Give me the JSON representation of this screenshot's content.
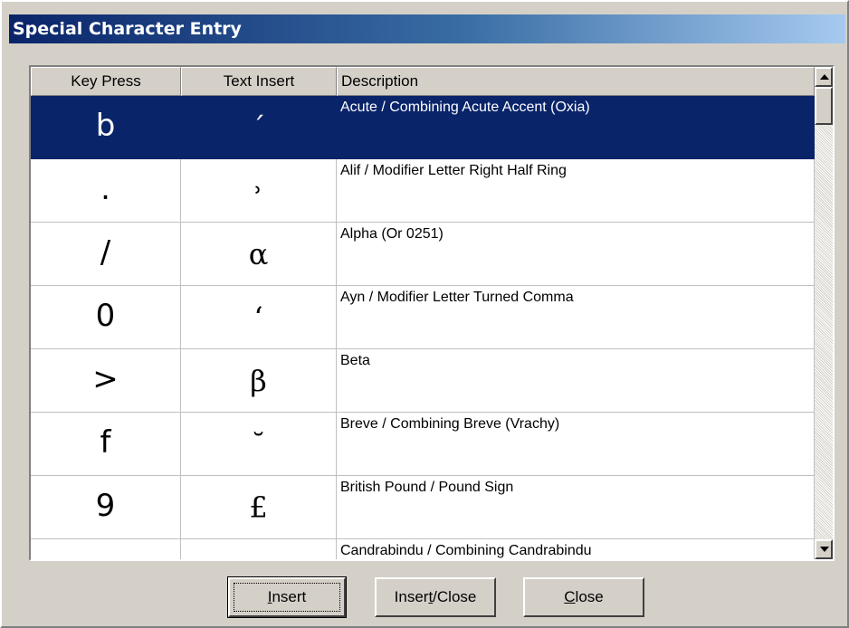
{
  "window": {
    "title": "Special Character Entry"
  },
  "table": {
    "columns": [
      "Key Press",
      "Text Insert",
      "Description"
    ],
    "selected_index": 0,
    "rows": [
      {
        "key": "b",
        "insert": "´",
        "description": "Acute / Combining Acute Accent (Oxia)"
      },
      {
        "key": ".",
        "insert": "˒",
        "description": "Alif / Modifier Letter Right Half Ring"
      },
      {
        "key": "/",
        "insert": "α",
        "description": "Alpha (Or 0251)"
      },
      {
        "key": "0",
        "insert": "ʻ",
        "description": "Ayn / Modifier Letter Turned Comma"
      },
      {
        "key": ">",
        "insert": "β",
        "description": "Beta"
      },
      {
        "key": "f",
        "insert": "˘",
        "description": "Breve / Combining Breve (Vrachy)"
      },
      {
        "key": "9",
        "insert": "£",
        "description": "British Pound / Pound Sign"
      },
      {
        "key": "",
        "insert": "",
        "description": "Candrabindu / Combining Candrabindu"
      }
    ]
  },
  "buttons": {
    "insert": {
      "before": "",
      "mnemonic": "I",
      "after": "nsert"
    },
    "insert_close": {
      "before": "Inser",
      "mnemonic": "t",
      "after": "/Close"
    },
    "close": {
      "before": "",
      "mnemonic": "C",
      "after": "lose"
    }
  },
  "scrollbar": {
    "position": 0.0
  }
}
